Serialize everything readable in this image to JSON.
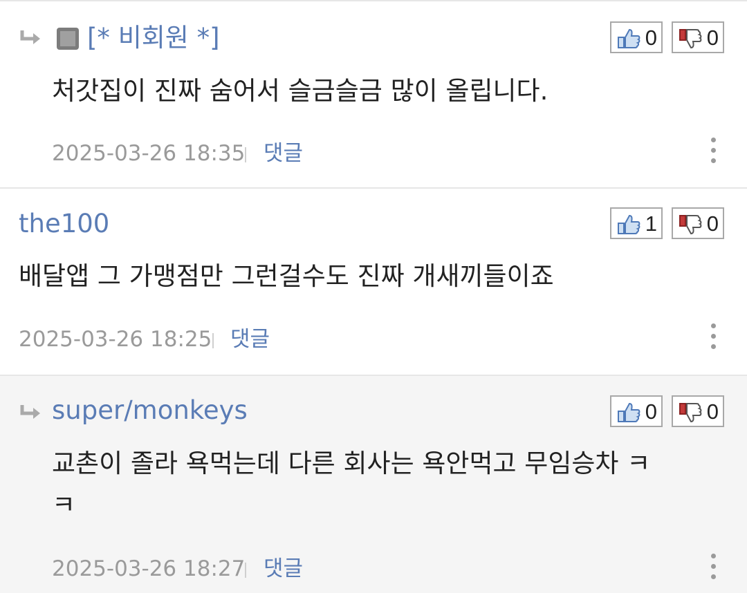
{
  "comments": [
    {
      "is_reply": true,
      "author": "[* 비회원 *]",
      "body_lines": [
        "처갓집이 진짜 숨어서 슬금슬금 많이 올립니다."
      ],
      "datetime": "2025-03-26 18:35",
      "reply_label": "댓글",
      "likes": "0",
      "dislikes": "0"
    },
    {
      "is_reply": false,
      "author": "the100",
      "body_lines": [
        "배달앱 그 가맹점만 그런걸수도 진짜 개새끼들이죠"
      ],
      "datetime": "2025-03-26 18:25",
      "reply_label": "댓글",
      "likes": "1",
      "dislikes": "0"
    },
    {
      "is_reply": true,
      "author": "super/monkeys",
      "body_lines": [
        "교촌이 졸라 욕먹는데 다른 회사는 욕안먹고 무임승차 ㅋ",
        "ㅋ"
      ],
      "datetime": "2025-03-26 18:27",
      "reply_label": "댓글",
      "likes": "0",
      "dislikes": "0"
    }
  ],
  "icons": {
    "reply_arrow": "reply-arrow-icon",
    "guest_badge": "guest-square-icon",
    "like": "thumbs-up-icon",
    "dislike": "thumbs-down-icon",
    "more": "more-vertical-icon"
  },
  "colors": {
    "author": "#5a7cb5",
    "reply_link": "#5a7cb5",
    "meta": "#9a9a9a",
    "reply_bg_highlight": "#f5f5f5"
  }
}
